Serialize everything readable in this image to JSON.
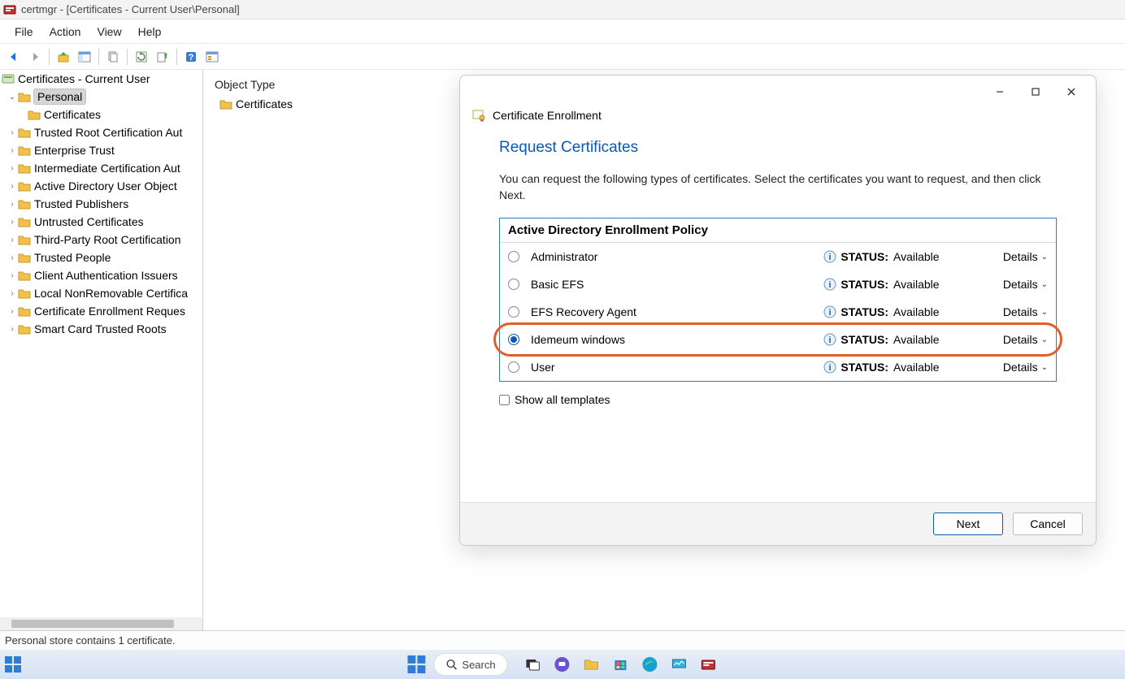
{
  "window": {
    "title": "certmgr - [Certificates - Current User\\Personal]"
  },
  "menu": {
    "file": "File",
    "action": "Action",
    "view": "View",
    "help": "Help"
  },
  "tree": {
    "root": "Certificates - Current User",
    "selected": "Personal",
    "selected_child": "Certificates",
    "items": [
      "Trusted Root Certification Aut",
      "Enterprise Trust",
      "Intermediate Certification Aut",
      "Active Directory User Object",
      "Trusted Publishers",
      "Untrusted Certificates",
      "Third-Party Root Certification",
      "Trusted People",
      "Client Authentication Issuers",
      "Local NonRemovable Certifica",
      "Certificate Enrollment Reques",
      "Smart Card Trusted Roots"
    ]
  },
  "content": {
    "object_type_header": "Object Type",
    "row": "Certificates"
  },
  "status": {
    "text": "Personal store contains 1 certificate."
  },
  "taskbar": {
    "search": "Search"
  },
  "dialog": {
    "crumb": "Certificate Enrollment",
    "heading": "Request Certificates",
    "description": "You can request the following types of certificates. Select the certificates you want to request, and then click Next.",
    "policy_header": "Active Directory Enrollment Policy",
    "templates": [
      {
        "name": "Administrator",
        "status_label": "STATUS:",
        "status": "Available",
        "details": "Details",
        "checked": false,
        "highlighted": false
      },
      {
        "name": "Basic EFS",
        "status_label": "STATUS:",
        "status": "Available",
        "details": "Details",
        "checked": false,
        "highlighted": false
      },
      {
        "name": "EFS Recovery Agent",
        "status_label": "STATUS:",
        "status": "Available",
        "details": "Details",
        "checked": false,
        "highlighted": false
      },
      {
        "name": "Idemeum windows",
        "status_label": "STATUS:",
        "status": "Available",
        "details": "Details",
        "checked": true,
        "highlighted": true
      },
      {
        "name": "User",
        "status_label": "STATUS:",
        "status": "Available",
        "details": "Details",
        "checked": false,
        "highlighted": false
      }
    ],
    "show_all": "Show all templates",
    "next": "Next",
    "cancel": "Cancel"
  }
}
